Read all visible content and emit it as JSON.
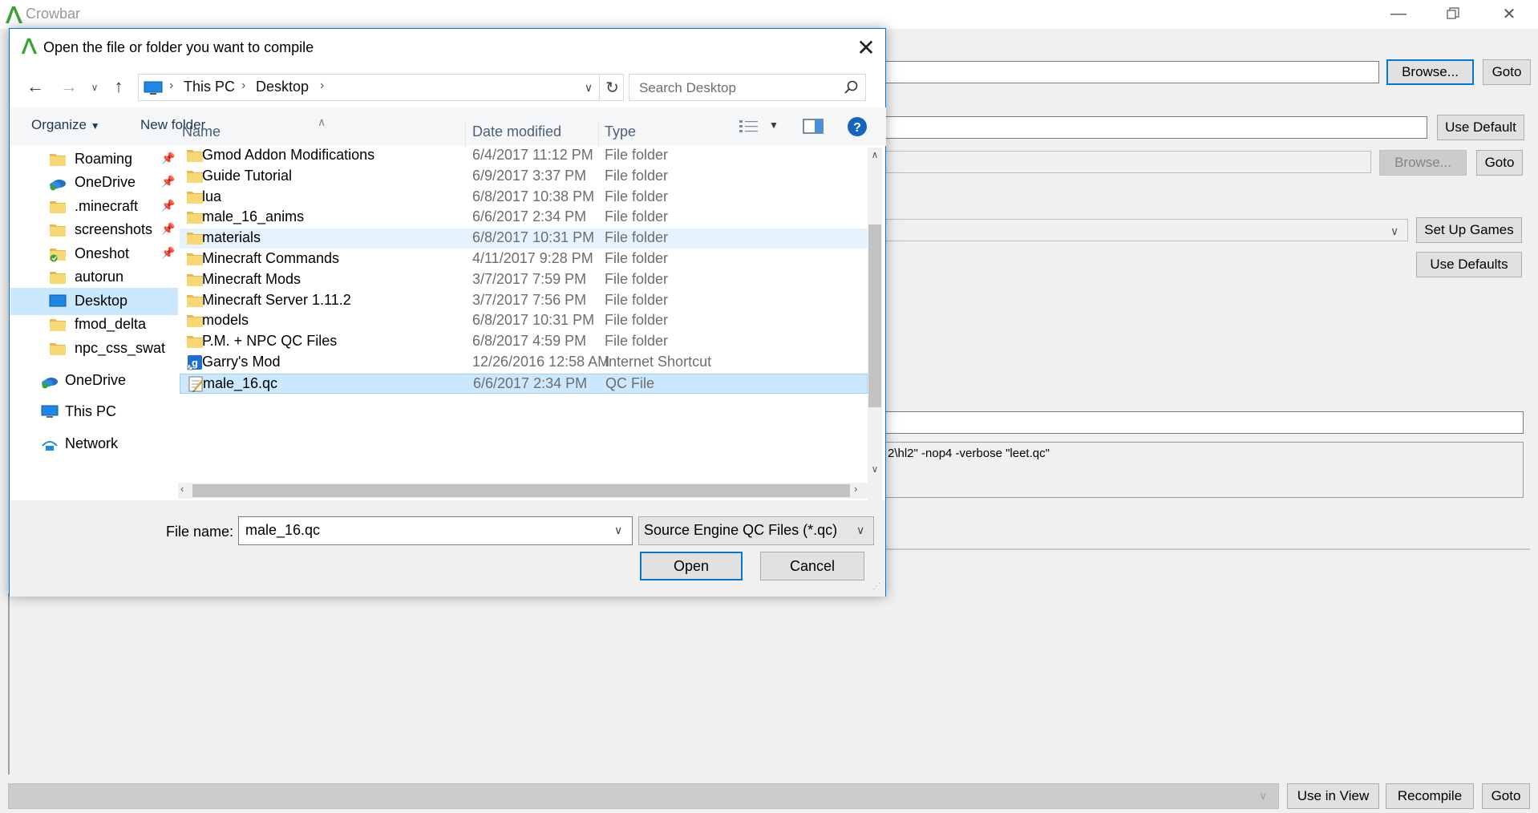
{
  "app": {
    "title": "Crowbar"
  },
  "main": {
    "browse1_label": "Browse...",
    "goto1_label": "Goto",
    "use_default_label": "Use Default",
    "browse2_label": "Browse...",
    "goto2_label": "Goto",
    "set_up_games_label": "Set Up Games",
    "use_defaults_label": "Use Defaults",
    "command_text": "2\\hl2\" -nop4 -verbose \"leet.qc\"",
    "use_in_view_label": "Use in View",
    "recompile_label": "Recompile",
    "goto3_label": "Goto"
  },
  "dialog": {
    "title": "Open the file or folder you want to compile",
    "breadcrumb": [
      "This PC",
      "Desktop"
    ],
    "search_placeholder": "Search Desktop",
    "organize_label": "Organize",
    "new_folder_label": "New folder",
    "nav": [
      {
        "label": "Roaming",
        "icon": "folder-icon",
        "pinned": true
      },
      {
        "label": "OneDrive",
        "icon": "onedrive-icon",
        "pinned": true
      },
      {
        "label": ".minecraft",
        "icon": "folder-icon",
        "pinned": true
      },
      {
        "label": "screenshots",
        "icon": "folder-icon",
        "pinned": true
      },
      {
        "label": "Oneshot",
        "icon": "folder-sync-icon",
        "pinned": true
      },
      {
        "label": "autorun",
        "icon": "folder-icon",
        "pinned": false
      },
      {
        "label": "Desktop",
        "icon": "desktop-icon",
        "pinned": false,
        "selected": true
      },
      {
        "label": "fmod_delta",
        "icon": "folder-icon",
        "pinned": false
      },
      {
        "label": "npc_css_swat",
        "icon": "folder-icon",
        "pinned": false
      },
      {
        "label": "OneDrive",
        "icon": "onedrive-icon",
        "pinned": false,
        "top": true
      },
      {
        "label": "This PC",
        "icon": "this-pc-icon",
        "pinned": false,
        "top": true
      },
      {
        "label": "Network",
        "icon": "network-icon",
        "pinned": false,
        "top": true
      }
    ],
    "columns": {
      "name": "Name",
      "date": "Date modified",
      "type": "Type"
    },
    "files": [
      {
        "name": "Gmod Addon Modifications",
        "date": "6/4/2017 11:12 PM",
        "type": "File folder",
        "icon": "folder-icon"
      },
      {
        "name": "Guide Tutorial",
        "date": "6/9/2017 3:37 PM",
        "type": "File folder",
        "icon": "folder-icon"
      },
      {
        "name": "lua",
        "date": "6/8/2017 10:38 PM",
        "type": "File folder",
        "icon": "folder-icon"
      },
      {
        "name": "male_16_anims",
        "date": "6/6/2017 2:34 PM",
        "type": "File folder",
        "icon": "folder-icon"
      },
      {
        "name": "materials",
        "date": "6/8/2017 10:31 PM",
        "type": "File folder",
        "icon": "folder-icon",
        "state": "hover"
      },
      {
        "name": "Minecraft Commands",
        "date": "4/11/2017 9:28 PM",
        "type": "File folder",
        "icon": "folder-icon"
      },
      {
        "name": "Minecraft Mods",
        "date": "3/7/2017 7:59 PM",
        "type": "File folder",
        "icon": "folder-icon"
      },
      {
        "name": "Minecraft Server 1.11.2",
        "date": "3/7/2017 7:56 PM",
        "type": "File folder",
        "icon": "folder-icon"
      },
      {
        "name": "models",
        "date": "6/8/2017 10:31 PM",
        "type": "File folder",
        "icon": "folder-icon"
      },
      {
        "name": "P.M. + NPC QC Files",
        "date": "6/8/2017 4:59 PM",
        "type": "File folder",
        "icon": "folder-icon"
      },
      {
        "name": "Garry's Mod",
        "date": "12/26/2016 12:58 AM",
        "type": "Internet Shortcut",
        "icon": "shortcut-icon"
      },
      {
        "name": "male_16.qc",
        "date": "6/6/2017 2:34 PM",
        "type": "QC File",
        "icon": "qc-file-icon",
        "state": "selected"
      }
    ],
    "file_name_label": "File name:",
    "file_name_value": "male_16.qc",
    "file_type_value": "Source Engine QC Files (*.qc)",
    "open_label": "Open",
    "cancel_label": "Cancel"
  },
  "colors": {
    "accent": "#0078d7",
    "selection": "#cce8ff",
    "hover": "#e5f3ff",
    "folder": "#f8d775"
  }
}
